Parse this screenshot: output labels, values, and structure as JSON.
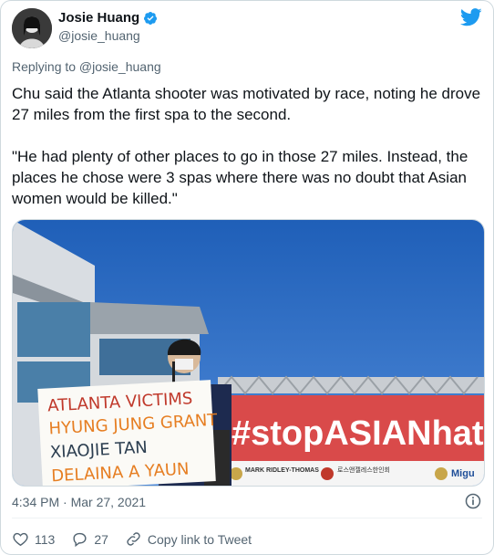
{
  "author": {
    "name": "Josie Huang",
    "handle": "@josie_huang"
  },
  "reply_context": "Replying to @josie_huang",
  "tweet": {
    "paragraph1": "Chu said the Atlanta shooter was motivated by race, noting he drove 27 miles from the first spa to the second.",
    "paragraph2": "\"He had plenty of other places to go in those 27 miles. Instead, the places he chose were 3 spas where there was no doubt that Asian women would be killed.\""
  },
  "media": {
    "sign_lines": [
      "ATLANTA VICTIMS",
      "HYUNG JUNG GRANT",
      "XIAOJIE TAN",
      "DELAINA A YAUN"
    ],
    "banner_text": "#stopASIANhate",
    "banner_sponsors": [
      "MARK RIDLEY-THOMAS",
      "로스앤젤레스한인회",
      "Migu"
    ]
  },
  "timestamp": "4:34 PM · Mar 27, 2021",
  "actions": {
    "likes": "113",
    "replies": "27",
    "copy_link": "Copy link to Tweet"
  },
  "colors": {
    "twitter_blue": "#1d9bf0",
    "muted": "#536471",
    "banner_red": "#d94a4a"
  },
  "icons": [
    "verified-badge-icon",
    "twitter-bird-icon",
    "info-icon",
    "heart-icon",
    "reply-icon",
    "link-icon"
  ]
}
